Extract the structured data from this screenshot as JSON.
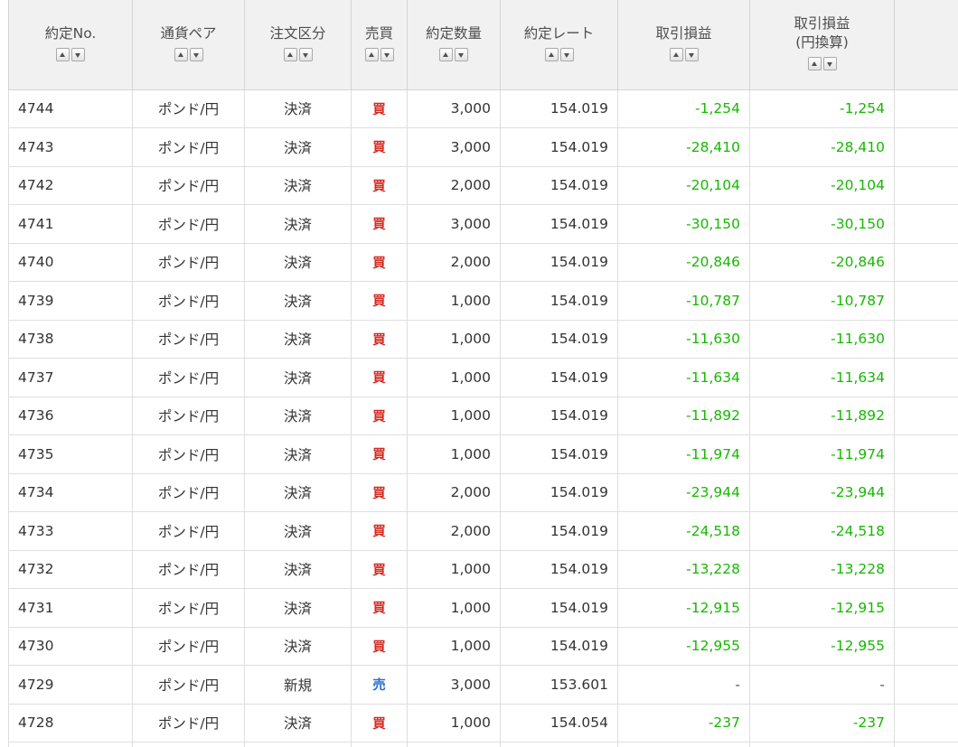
{
  "table": {
    "headers": [
      {
        "key": "no",
        "lines": [
          "約定No."
        ]
      },
      {
        "key": "pair",
        "lines": [
          "通貨ペア"
        ]
      },
      {
        "key": "type",
        "lines": [
          "注文区分"
        ]
      },
      {
        "key": "side",
        "lines": [
          "売買"
        ]
      },
      {
        "key": "qty",
        "lines": [
          "約定数量"
        ]
      },
      {
        "key": "rate",
        "lines": [
          "約定レート"
        ]
      },
      {
        "key": "pl",
        "lines": [
          "取引損益"
        ]
      },
      {
        "key": "plj",
        "lines": [
          "取引損益",
          "(円換算)"
        ]
      }
    ],
    "rows": [
      {
        "no": "4744",
        "pair": "ポンド/円",
        "type": "決済",
        "side": "買",
        "qty": "3,000",
        "rate": "154.019",
        "pl": "-1,254",
        "plj": "-1,254"
      },
      {
        "no": "4743",
        "pair": "ポンド/円",
        "type": "決済",
        "side": "買",
        "qty": "3,000",
        "rate": "154.019",
        "pl": "-28,410",
        "plj": "-28,410"
      },
      {
        "no": "4742",
        "pair": "ポンド/円",
        "type": "決済",
        "side": "買",
        "qty": "2,000",
        "rate": "154.019",
        "pl": "-20,104",
        "plj": "-20,104"
      },
      {
        "no": "4741",
        "pair": "ポンド/円",
        "type": "決済",
        "side": "買",
        "qty": "3,000",
        "rate": "154.019",
        "pl": "-30,150",
        "plj": "-30,150"
      },
      {
        "no": "4740",
        "pair": "ポンド/円",
        "type": "決済",
        "side": "買",
        "qty": "2,000",
        "rate": "154.019",
        "pl": "-20,846",
        "plj": "-20,846"
      },
      {
        "no": "4739",
        "pair": "ポンド/円",
        "type": "決済",
        "side": "買",
        "qty": "1,000",
        "rate": "154.019",
        "pl": "-10,787",
        "plj": "-10,787"
      },
      {
        "no": "4738",
        "pair": "ポンド/円",
        "type": "決済",
        "side": "買",
        "qty": "1,000",
        "rate": "154.019",
        "pl": "-11,630",
        "plj": "-11,630"
      },
      {
        "no": "4737",
        "pair": "ポンド/円",
        "type": "決済",
        "side": "買",
        "qty": "1,000",
        "rate": "154.019",
        "pl": "-11,634",
        "plj": "-11,634"
      },
      {
        "no": "4736",
        "pair": "ポンド/円",
        "type": "決済",
        "side": "買",
        "qty": "1,000",
        "rate": "154.019",
        "pl": "-11,892",
        "plj": "-11,892"
      },
      {
        "no": "4735",
        "pair": "ポンド/円",
        "type": "決済",
        "side": "買",
        "qty": "1,000",
        "rate": "154.019",
        "pl": "-11,974",
        "plj": "-11,974"
      },
      {
        "no": "4734",
        "pair": "ポンド/円",
        "type": "決済",
        "side": "買",
        "qty": "2,000",
        "rate": "154.019",
        "pl": "-23,944",
        "plj": "-23,944"
      },
      {
        "no": "4733",
        "pair": "ポンド/円",
        "type": "決済",
        "side": "買",
        "qty": "2,000",
        "rate": "154.019",
        "pl": "-24,518",
        "plj": "-24,518"
      },
      {
        "no": "4732",
        "pair": "ポンド/円",
        "type": "決済",
        "side": "買",
        "qty": "1,000",
        "rate": "154.019",
        "pl": "-13,228",
        "plj": "-13,228"
      },
      {
        "no": "4731",
        "pair": "ポンド/円",
        "type": "決済",
        "side": "買",
        "qty": "1,000",
        "rate": "154.019",
        "pl": "-12,915",
        "plj": "-12,915"
      },
      {
        "no": "4730",
        "pair": "ポンド/円",
        "type": "決済",
        "side": "買",
        "qty": "1,000",
        "rate": "154.019",
        "pl": "-12,955",
        "plj": "-12,955"
      },
      {
        "no": "4729",
        "pair": "ポンド/円",
        "type": "新規",
        "side": "売",
        "qty": "3,000",
        "rate": "153.601",
        "pl": "-",
        "plj": "-"
      },
      {
        "no": "4728",
        "pair": "ポンド/円",
        "type": "決済",
        "side": "買",
        "qty": "1,000",
        "rate": "154.054",
        "pl": "-237",
        "plj": "-237"
      }
    ]
  },
  "colors": {
    "loss": "#16b800",
    "buy": "#d4291f",
    "sell": "#2a6fd0",
    "header_bg": "#f1f1f1",
    "border": "#dedede"
  },
  "icons": {
    "sort_asc": "triangle-up-icon",
    "sort_desc": "triangle-down-icon"
  }
}
